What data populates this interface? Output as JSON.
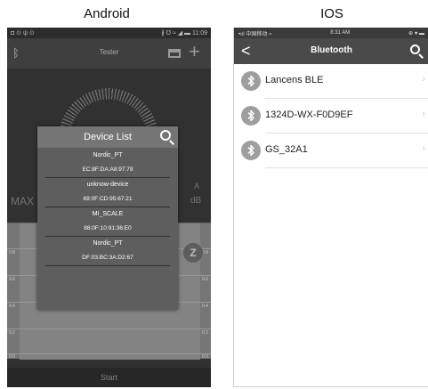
{
  "labels": {
    "android": "Android",
    "ios": "IOS"
  },
  "android": {
    "status": {
      "left": "◘ ⊙ ψ ⊙",
      "right": "∦ ℧ ≈ ◢ ▬ 11:09"
    },
    "toolbar": {
      "title": "Tester"
    },
    "max_label": "MAX",
    "unit_a": "A",
    "unit_db": "dB",
    "chart": {
      "y_ticks": [
        "0.8",
        "0.6",
        "0.4",
        "0.2",
        "0.0"
      ]
    },
    "z_button": "Z",
    "start_button": "Start",
    "device_list": {
      "title": "Device List",
      "devices": [
        {
          "name": "Nordic_PT",
          "mac": "EC:8F:DA:A8:97:79"
        },
        {
          "name": "unknow-device",
          "mac": "69:0F:CD:95:67:21"
        },
        {
          "name": "MI_SCALE",
          "mac": "88:0F:10:91:36:E0"
        },
        {
          "name": "Nordic_PT",
          "mac": "DF:03:BC:3A:D2:67"
        }
      ]
    }
  },
  "ios": {
    "status": {
      "left": "•ııl 中国移动 ≈",
      "time": "8:31 AM",
      "right": "⊕ ♥ ▬"
    },
    "nav": {
      "back": "<",
      "title": "Bluetooth"
    },
    "devices": [
      {
        "name": "Lancens BLE"
      },
      {
        "name": "1324D-WX-F0D9EF"
      },
      {
        "name": "GS_32A1"
      }
    ]
  },
  "icons": [
    "bluetooth-icon",
    "tag-icon",
    "plus-icon",
    "search-icon",
    "back-chevron-icon",
    "chevron-right-icon"
  ],
  "colors": {
    "android_bg": "#3a3a3a",
    "dialog_bg": "#5e5e5e",
    "ios_nav": "#4a4a4a",
    "ios_icon": "#9e9e9e"
  }
}
